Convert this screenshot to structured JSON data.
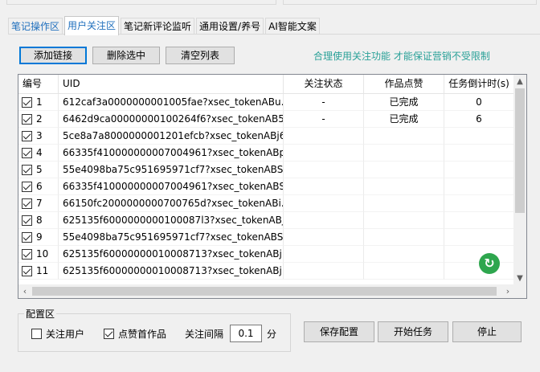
{
  "tabs": [
    {
      "label": "笔记操作区"
    },
    {
      "label": "用户关注区"
    },
    {
      "label": "笔记新评论监听"
    },
    {
      "label": "通用设置/养号"
    },
    {
      "label": "AI智能文案"
    }
  ],
  "toolbar": {
    "add_label": "添加链接",
    "delete_label": "删除选中",
    "clear_label": "清空列表",
    "notice": "合理使用关注功能 才能保证营销不受限制"
  },
  "table": {
    "columns": [
      "编号",
      "UID",
      "关注状态",
      "作品点赞",
      "任务倒计时(s)"
    ],
    "rows": [
      {
        "checked": true,
        "num": "1",
        "uid": "612caf3a0000000001005fae?xsec_tokenABu...",
        "follow": "-",
        "like": "已完成",
        "countdown": "0"
      },
      {
        "checked": true,
        "num": "2",
        "uid": "6462d9ca00000000100264f6?xsec_tokenAB5...",
        "follow": "-",
        "like": "已完成",
        "countdown": "6"
      },
      {
        "checked": true,
        "num": "3",
        "uid": "5ce8a7a8000000001201efcb?xsec_tokenABj6...",
        "follow": "",
        "like": "",
        "countdown": ""
      },
      {
        "checked": true,
        "num": "4",
        "uid": "66335f410000000007004961?xsec_tokenABp...",
        "follow": "",
        "like": "",
        "countdown": ""
      },
      {
        "checked": true,
        "num": "5",
        "uid": "55e4098ba75c951695971cf7?xsec_tokenABS...",
        "follow": "",
        "like": "",
        "countdown": ""
      },
      {
        "checked": true,
        "num": "6",
        "uid": "66335f410000000007004961?xsec_tokenABS...",
        "follow": "",
        "like": "",
        "countdown": ""
      },
      {
        "checked": true,
        "num": "7",
        "uid": "66150fc2000000000700765d?xsec_tokenABi...",
        "follow": "",
        "like": "",
        "countdown": ""
      },
      {
        "checked": true,
        "num": "8",
        "uid": "625135f6000000000100087l3?xsec_tokenABj...",
        "follow": "",
        "like": "",
        "countdown": ""
      },
      {
        "checked": true,
        "num": "9",
        "uid": "55e4098ba75c951695971cf7?xsec_tokenABS...",
        "follow": "",
        "like": "",
        "countdown": ""
      },
      {
        "checked": true,
        "num": "10",
        "uid": "625135f60000000010008713?xsec_tokenABj...",
        "follow": "",
        "like": "",
        "countdown": ""
      },
      {
        "checked": true,
        "num": "11",
        "uid": "625135f60000000010008713?xsec_tokenABj...",
        "follow": "",
        "like": "",
        "countdown": ""
      }
    ]
  },
  "config": {
    "title": "配置区",
    "follow_user_label": "关注用户",
    "follow_user_checked": false,
    "like_first_label": "点赞首作品",
    "like_first_checked": true,
    "interval_label": "关注间隔",
    "interval_value": "0.1",
    "interval_unit": "分"
  },
  "actions": {
    "save_label": "保存配置",
    "start_label": "开始任务",
    "stop_label": "停止"
  },
  "icons": {
    "refresh": "refresh-icon",
    "check": "checkmark-icon"
  },
  "colors": {
    "notice": "#2aa198",
    "active_tab": "#1f6fbd",
    "refresh_button": "#2ea64e"
  }
}
